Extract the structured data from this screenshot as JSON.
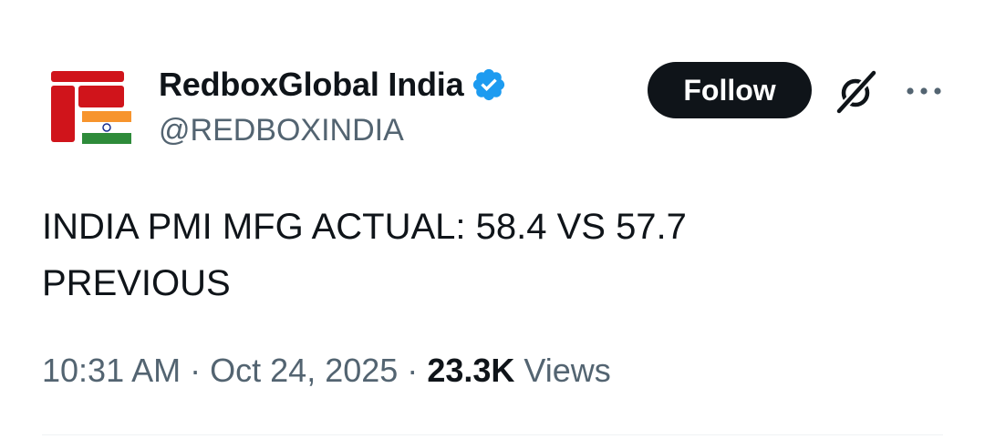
{
  "account": {
    "display_name": "RedboxGlobal India",
    "handle": "@REDBOXINDIA",
    "verified": true,
    "avatar_icon": "redbox-india-logo"
  },
  "actions": {
    "follow_label": "Follow",
    "grok_icon": "grok-icon",
    "more_icon": "more-icon"
  },
  "tweet": {
    "text_line1": "INDIA PMI MFG ACTUAL: 58.4 VS 57.7",
    "text_line2": "PREVIOUS"
  },
  "meta": {
    "time": "10:31 AM",
    "separator": "·",
    "date": "Oct 24, 2025",
    "views_count": "23.3K",
    "views_label": "Views"
  },
  "colors": {
    "brand_red": "#d0141b",
    "verified_blue": "#1d9bf0",
    "text_primary": "#0f1419",
    "text_secondary": "#536471",
    "saffron": "#f7942d",
    "green": "#2e8b3a"
  }
}
